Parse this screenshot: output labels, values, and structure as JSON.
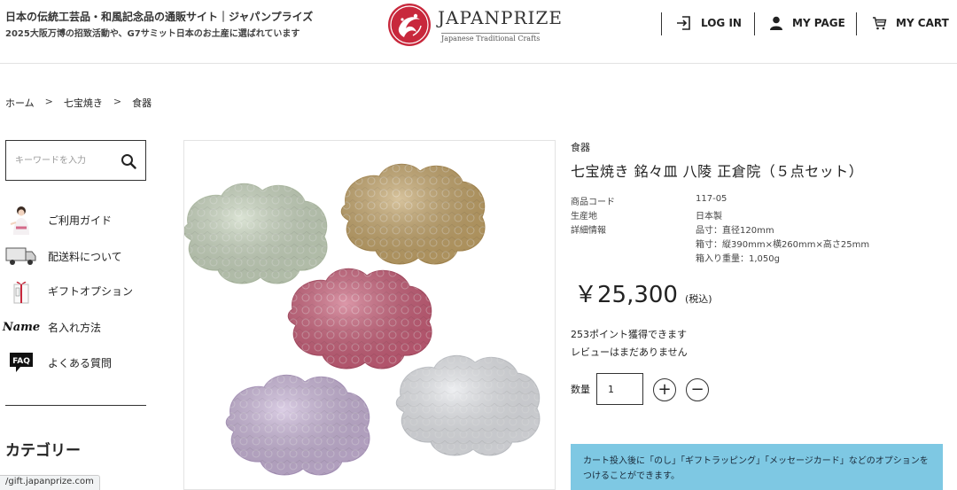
{
  "header": {
    "tagline": "日本の伝統工芸品・和風記念品の通販サイト｜ジャパンプライズ",
    "subtagline": "2025大阪万博の招致活動や、G7サミット日本のお土産に選ばれています",
    "logo_text": "JAPANPRIZE",
    "logo_sub": "Japanese Traditional Crafts",
    "nav": {
      "login": "LOG IN",
      "mypage": "MY PAGE",
      "cart": "MY CART"
    }
  },
  "breadcrumb": {
    "items": [
      "ホーム",
      "七宝焼き",
      "食器"
    ],
    "separator": ">"
  },
  "sidebar": {
    "search_placeholder": "キーワードを入力",
    "items": [
      {
        "label": "ご利用ガイド",
        "icon": "person-guide-icon"
      },
      {
        "label": "配送料について",
        "icon": "truck-icon"
      },
      {
        "label": "ギフトオプション",
        "icon": "gift-icon"
      },
      {
        "label": "名入れ方法",
        "icon": "name-script-icon",
        "icon_text": "Name"
      },
      {
        "label": "よくある質問",
        "icon": "faq-icon",
        "icon_text": "FAQ"
      }
    ],
    "category_title": "カテゴリー"
  },
  "status_bar": {
    "url": "/gift.japanprize.com"
  },
  "product": {
    "category": "食器",
    "title": "七宝焼き 銘々皿 八陵 正倉院（５点セット）",
    "specs": [
      {
        "label": "商品コード",
        "value": "117-05"
      },
      {
        "label": "生産地",
        "value": "日本製"
      },
      {
        "label": "詳細情報",
        "value": "品寸：直径120mm"
      },
      {
        "label": "",
        "value": "箱寸：縦390mm×横260mm×高さ25mm"
      },
      {
        "label": "",
        "value": "箱入り重量：1,050g"
      }
    ],
    "price": "￥25,300",
    "price_tax": "(税込)",
    "points": "253ポイント獲得できます",
    "reviews": "レビューはまだありません",
    "quantity_label": "数量",
    "quantity_value": "1",
    "plus": "+",
    "minus": "−",
    "notice": "カート投入後に「のし」「ギフトラッピング」「メッセージカード」などのオプションをつけることができます。"
  },
  "colors": {
    "notice_bg": "#7ec8e3",
    "logo_red": "#c8283c",
    "plate_green": "#c9d6bf",
    "plate_gold": "#c4a56a",
    "plate_pink": "#c9607a",
    "plate_purple": "#c9b5d8",
    "plate_silver": "#e4e6ea"
  }
}
